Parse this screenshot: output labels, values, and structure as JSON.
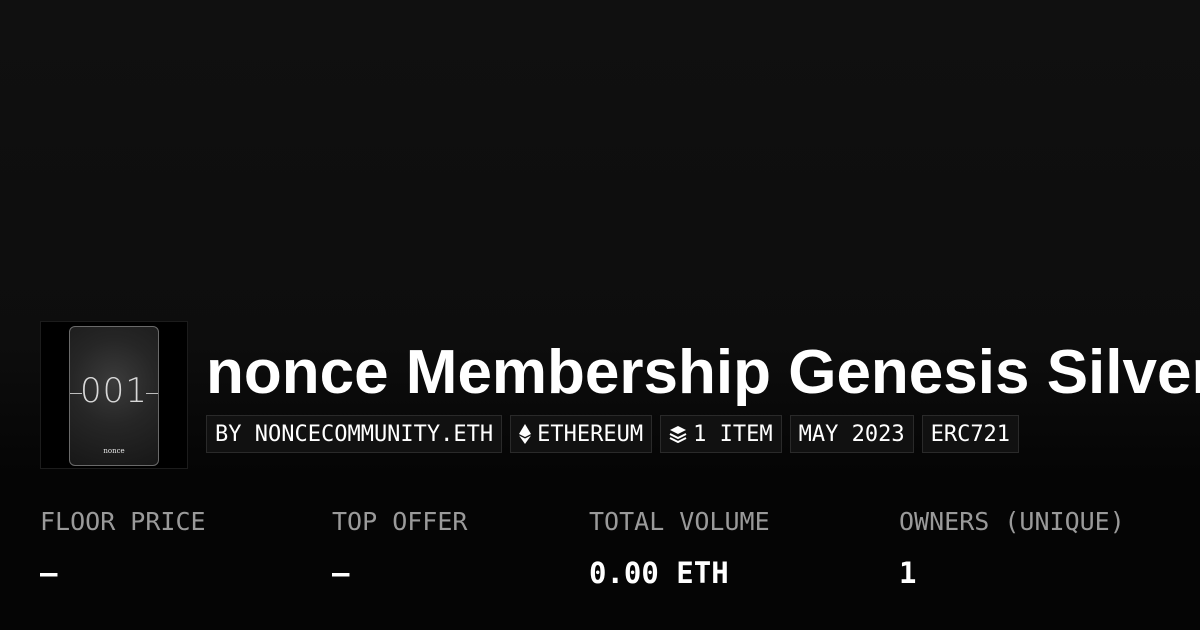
{
  "collection": {
    "title": "nonce Membership Genesis Silver",
    "thumbnail": {
      "number": "001",
      "label": "nonce"
    }
  },
  "tags": [
    {
      "text": "BY NONCECOMMUNITY.ETH",
      "icon": null
    },
    {
      "text": "ETHEREUM",
      "icon": "ethereum-icon"
    },
    {
      "text": "1 ITEM",
      "icon": "layers-icon"
    },
    {
      "text": "MAY 2023",
      "icon": null
    },
    {
      "text": "ERC721",
      "icon": null
    }
  ],
  "stats": [
    {
      "label": "FLOOR PRICE",
      "value": "–"
    },
    {
      "label": "TOP OFFER",
      "value": "–"
    },
    {
      "label": "TOTAL VOLUME",
      "value": "0.00 ETH"
    },
    {
      "label": "OWNERS (UNIQUE)",
      "value": "1"
    }
  ],
  "colors": {
    "background": "#0b0b0b",
    "label": "#9a9a9a",
    "text": "#ffffff"
  }
}
